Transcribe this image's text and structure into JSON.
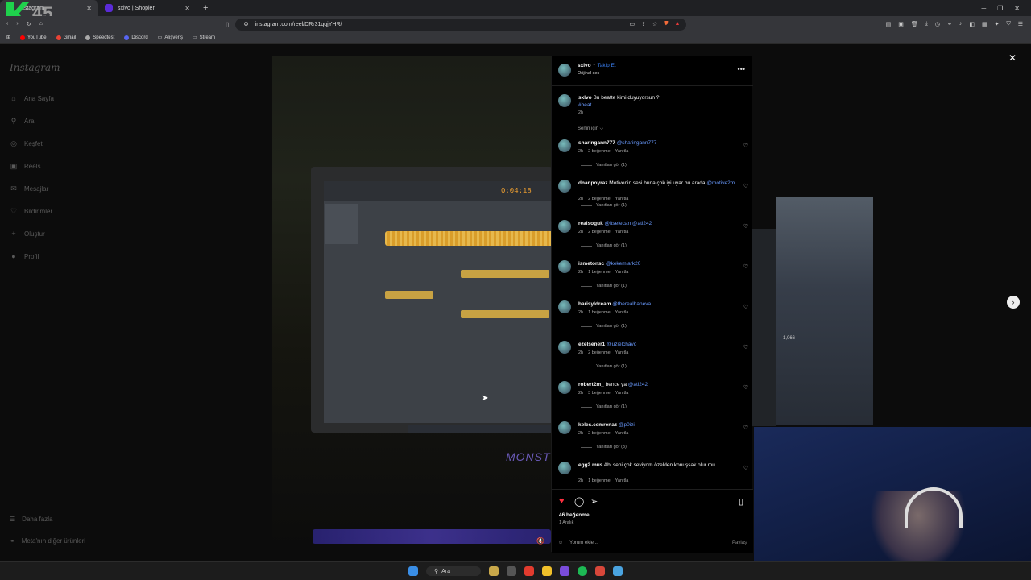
{
  "browser": {
    "tabs": [
      {
        "label": "Instagram",
        "active": true,
        "color": "#e1306c"
      },
      {
        "label": "sxlvo | Shopier",
        "active": false,
        "color": "#5b2bd8"
      }
    ],
    "overlay_text": "45",
    "url": "instagram.com/reel/DRr31qqjYHR/",
    "bookmarks": [
      {
        "label": "YouTube",
        "color": "#ff0000"
      },
      {
        "label": "Gmail",
        "color": "#ea4335"
      },
      {
        "label": "Speedtest",
        "color": "#aaaaaa"
      },
      {
        "label": "Discord",
        "color": "#5865f2"
      },
      {
        "label": "Alışveriş",
        "color": "#888888"
      },
      {
        "label": "Stream",
        "color": "#888888"
      }
    ]
  },
  "sidebar": {
    "logo": "Instagram",
    "items": [
      {
        "label": "Ana Sayfa",
        "icon": "home-icon",
        "glyph": "⌂"
      },
      {
        "label": "Ara",
        "icon": "search-icon",
        "glyph": "⚲"
      },
      {
        "label": "Keşfet",
        "icon": "compass-icon",
        "glyph": "◎"
      },
      {
        "label": "Reels",
        "icon": "reels-icon",
        "glyph": "▣"
      },
      {
        "label": "Mesajlar",
        "icon": "messenger-icon",
        "glyph": "✉"
      },
      {
        "label": "Bildirimler",
        "icon": "heart-icon",
        "glyph": "♡"
      },
      {
        "label": "Oluştur",
        "icon": "plus-icon",
        "glyph": "+"
      },
      {
        "label": "Profil",
        "icon": "profile-icon",
        "glyph": "●"
      }
    ],
    "more": "Daha fazla",
    "meta": "Meta'nın diğer ürünleri"
  },
  "video": {
    "timer": "0:04:18",
    "brand": "MONSTE",
    "counter": "1,066"
  },
  "post": {
    "username": "sxlvo",
    "separator": "•",
    "follow": "Takip Et",
    "audio": "Orijinal ses",
    "caption_user": "sxlvo",
    "caption_text": "Bu beatte kimi duyuyorsun ?",
    "caption_tag": "#beat",
    "caption_time": "2h",
    "for_you": "Senin için ⌵",
    "likes": "46 beğenme",
    "date": "1 Aralık",
    "add_comment_placeholder": "Yorum ekle...",
    "post_label": "Paylaş"
  },
  "comments": [
    {
      "user": "sharingann777",
      "text": "",
      "mention": "@sharingann777",
      "time": "2h",
      "likes": "2 beğenme",
      "reply": "Yanıtla",
      "view": "Yanıtları gör (1)"
    },
    {
      "user": "dnanpoyraz",
      "text": "Motivenin sesi buna çok iyi uyar bu arada",
      "mention": "@motive2m",
      "time": "2h",
      "likes": "2 beğenme",
      "reply": "Yanıtla",
      "view": "Yanıtları gör (1)"
    },
    {
      "user": "realsoguk",
      "text": "",
      "mention": "@itsefecan @ati242_",
      "time": "2h",
      "likes": "2 beğenme",
      "reply": "Yanıtla",
      "view": "Yanıtları gör (1)"
    },
    {
      "user": "ismetonsc",
      "text": "",
      "mention": "@kekemlark20",
      "time": "2h",
      "likes": "1 beğenme",
      "reply": "Yanıtla",
      "view": "Yanıtları gör (1)"
    },
    {
      "user": "barisyldream",
      "text": "",
      "mention": "@therealbaneva",
      "time": "2h",
      "likes": "1 beğenme",
      "reply": "Yanıtla",
      "view": "Yanıtları gör (1)"
    },
    {
      "user": "ezelsener1",
      "text": "",
      "mention": "@uzielchavo",
      "time": "2h",
      "likes": "2 beğenme",
      "reply": "Yanıtla",
      "view": "Yanıtları gör (1)"
    },
    {
      "user": "robert2m_",
      "text": "bence ya",
      "mention": "@ati242_",
      "time": "2h",
      "likes": "3 beğenme",
      "reply": "Yanıtla",
      "view": "Yanıtları gör (1)"
    },
    {
      "user": "keles.cemrenaz",
      "text": "",
      "mention": "@p0izi",
      "time": "2h",
      "likes": "2 beğenme",
      "reply": "Yanıtla",
      "view": "Yanıtları gör (3)"
    },
    {
      "user": "egg2.mus",
      "text": "Abi seni çok seviyom özelden konuşsak olur mu",
      "mention": "",
      "time": "2h",
      "likes": "1 beğenme",
      "reply": "Yanıtla",
      "view": ""
    }
  ],
  "taskbar": {
    "search": "Ara",
    "colors": [
      "#3a8ee6",
      "#c9a84a",
      "#e23b2e",
      "#f0c02a",
      "#7a4cdb",
      "#1db954",
      "#d8473a",
      "#4aa3df"
    ]
  }
}
